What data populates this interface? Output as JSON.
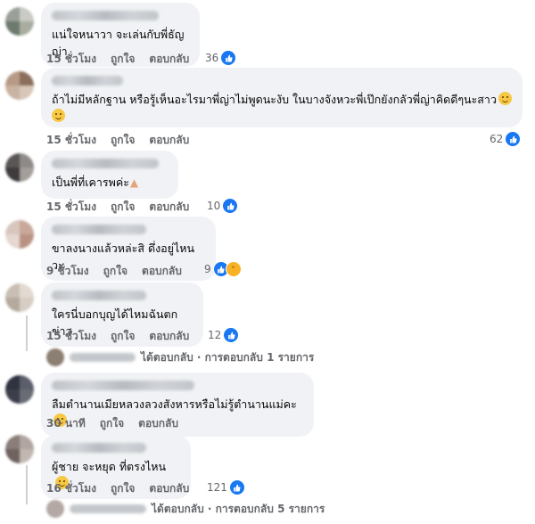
{
  "comments": [
    {
      "text": "แน่ใจหนาวา จะเล่นกับพี่ธัญญ่า",
      "time": "15 ชั่วโมง",
      "like": "ถูกใจ",
      "reply": "ตอบกลับ",
      "count": "36"
    },
    {
      "text": "ถ้าไม่มีหลักฐาน หรือรู้เห็นอะไรมาพี่ญ่าไม่พูดนะงับ ในบางจังหวะพี่เป๊กยังกลัวพี่ญ่าคิดดีๆนะสาว",
      "time": "15 ชั่วโมง",
      "like": "ถูกใจ",
      "reply": "ตอบกลับ",
      "count": "62"
    },
    {
      "text": "เป็นพี่ที่เคารพค่ะ",
      "time": "15 ชั่วโมง",
      "like": "ถูกใจ",
      "reply": "ตอบกลับ",
      "count": "10"
    },
    {
      "text": "ขาลงนางแล้วหล่ะสิ ดึ่งอยู่ไหนวะ",
      "time": "9 ชั่วโมง",
      "like": "ถูกใจ",
      "reply": "ตอบกลับ",
      "count": "9"
    },
    {
      "text": "ใครนี่บอกบุญได้ไหมฉันตกข่าว",
      "time": "15 ชั่วโมง",
      "like": "ถูกใจ",
      "reply": "ตอบกลับ",
      "count": "12",
      "replies": "ได้ตอบกลับ · การตอบกลับ 1 รายการ"
    },
    {
      "text": "ลืมตำนานเมียหลวงลวงสังหารหรือไม่รู้ตำนานแม่คะ",
      "time": "30 นาที",
      "like": "ถูกใจ",
      "reply": "ตอบกลับ"
    },
    {
      "text": "ผู้ชาย จะหยุด ที่ตรงไหน",
      "time": "16 ชั่วโมง",
      "like": "ถูกใจ",
      "reply": "ตอบกลับ",
      "count": "121",
      "replies": "ได้ตอบกลับ · การตอบกลับ 5 รายการ"
    }
  ],
  "colors": {
    "like_blue": "#1877f2",
    "bubble": "#f0f2f5",
    "meta": "#65676b"
  }
}
